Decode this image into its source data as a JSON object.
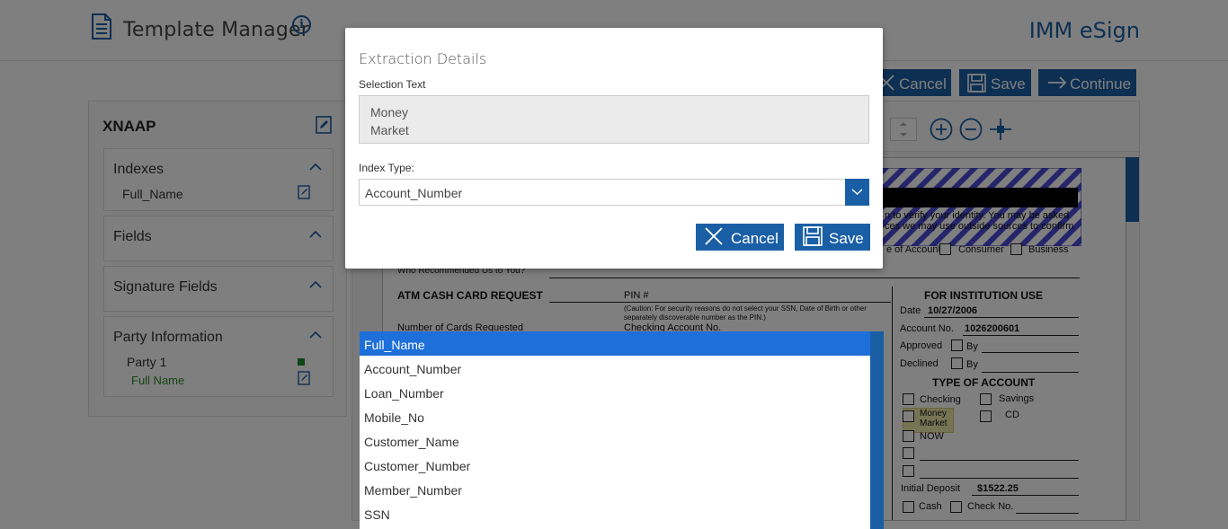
{
  "header": {
    "title": "Template Manager",
    "brand": "IMM eSign",
    "info_icon": "info-icon"
  },
  "left_panel": {
    "title": "XNAAP",
    "sections": [
      {
        "title": "Indexes",
        "items": [
          "Full_Name"
        ]
      },
      {
        "title": "Fields",
        "items": []
      },
      {
        "title": "Signature Fields",
        "items": []
      },
      {
        "title": "Party Information",
        "party": "Party 1",
        "items": [
          "Full Name"
        ]
      }
    ]
  },
  "toolbar": {
    "cancel_label": "Cancel",
    "save_label": "Save",
    "continue_label": "Continue"
  },
  "document": {
    "verify_text": "n to verify your identity. You may be asked",
    "verify_text2": "ces we may use outside sources to confirm",
    "account_opts": [
      "e of Account",
      "Consumer",
      "Business"
    ],
    "who_recommended": "Who Recommended Us to You?",
    "atm_heading": "ATM CASH CARD REQUEST",
    "pin_label": "PIN #",
    "caution": "(Caution: For security reasons do not select your SSN, Date of Birth or other",
    "caution2": "separately discoverable number as the PIN.)",
    "num_cards": "Number of Cards Requested",
    "checking_acct": "Checking Account No.",
    "institution_heading": "FOR INSTITUTION USE",
    "date_label": "Date",
    "date_value": "10/27/2006",
    "account_no_label": "Account No.",
    "account_no_value": "1026200601",
    "approved": "Approved",
    "declined": "Declined",
    "by": "By",
    "type_heading": "TYPE OF ACCOUNT",
    "checking": "Checking",
    "savings": "Savings",
    "money": "Money",
    "market": "Market",
    "cd": "CD",
    "now": "NOW",
    "initial_deposit_label": "Initial Deposit",
    "initial_deposit_value": "$1522.25",
    "cash": "Cash",
    "check_no": "Check No."
  },
  "modal": {
    "title": "Extraction Details",
    "selection_label": "Selection Text",
    "selection_lines": [
      "Money",
      "Market"
    ],
    "index_type_label": "Index Type:",
    "index_type_value": "Account_Number",
    "cancel_label": "Cancel",
    "save_label": "Save"
  },
  "dropdown": {
    "options": [
      "Full_Name",
      "Account_Number",
      "Loan_Number",
      "Mobile_No",
      "Customer_Name",
      "Customer_Number",
      "Member_Number",
      "SSN"
    ],
    "highlighted": "Full_Name"
  },
  "colors": {
    "accent": "#1a5fa5",
    "highlight": "#1e6fd9",
    "party_green": "#2a8a2a"
  }
}
